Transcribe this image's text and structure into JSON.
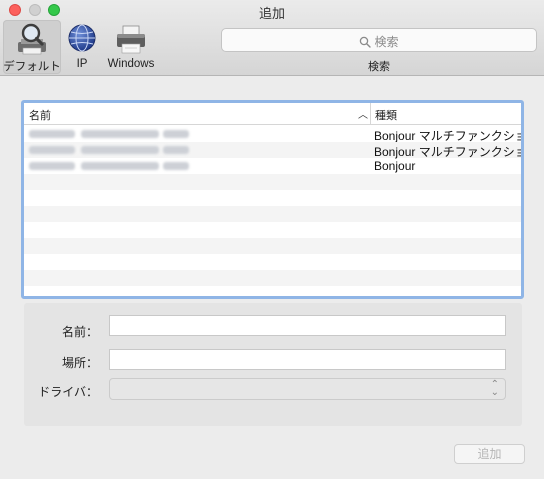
{
  "window": {
    "title": "追加"
  },
  "toolbar": {
    "items": [
      {
        "label": "デフォルト",
        "icon": "magnifier-printer-icon",
        "selected": true
      },
      {
        "label": "IP",
        "icon": "globe-icon",
        "selected": false
      },
      {
        "label": "Windows",
        "icon": "printer-icon",
        "selected": false
      }
    ],
    "search": {
      "placeholder": "検索",
      "caption": "検索"
    }
  },
  "printer_list": {
    "columns": [
      "名前",
      "種類"
    ],
    "sort_column": "名前",
    "sort_direction": "ascending",
    "rows": [
      {
        "name": "",
        "name_obscured": true,
        "kind": "Bonjour マルチファンクション"
      },
      {
        "name": "",
        "name_obscured": true,
        "kind": "Bonjour マルチファンクション"
      },
      {
        "name": "",
        "name_obscured": true,
        "kind": "Bonjour"
      }
    ]
  },
  "form": {
    "name_label": "名前：",
    "name_value": "",
    "location_label": "場所：",
    "location_value": "",
    "driver_label": "ドライバ：",
    "driver_value": ""
  },
  "actions": {
    "add_label": "追加",
    "add_enabled": false
  },
  "colors": {
    "close": "#fc605c",
    "minimize": "#d0d0d0",
    "zoom": "#34c84a",
    "list_focus_ring": "#8fb5e6"
  }
}
